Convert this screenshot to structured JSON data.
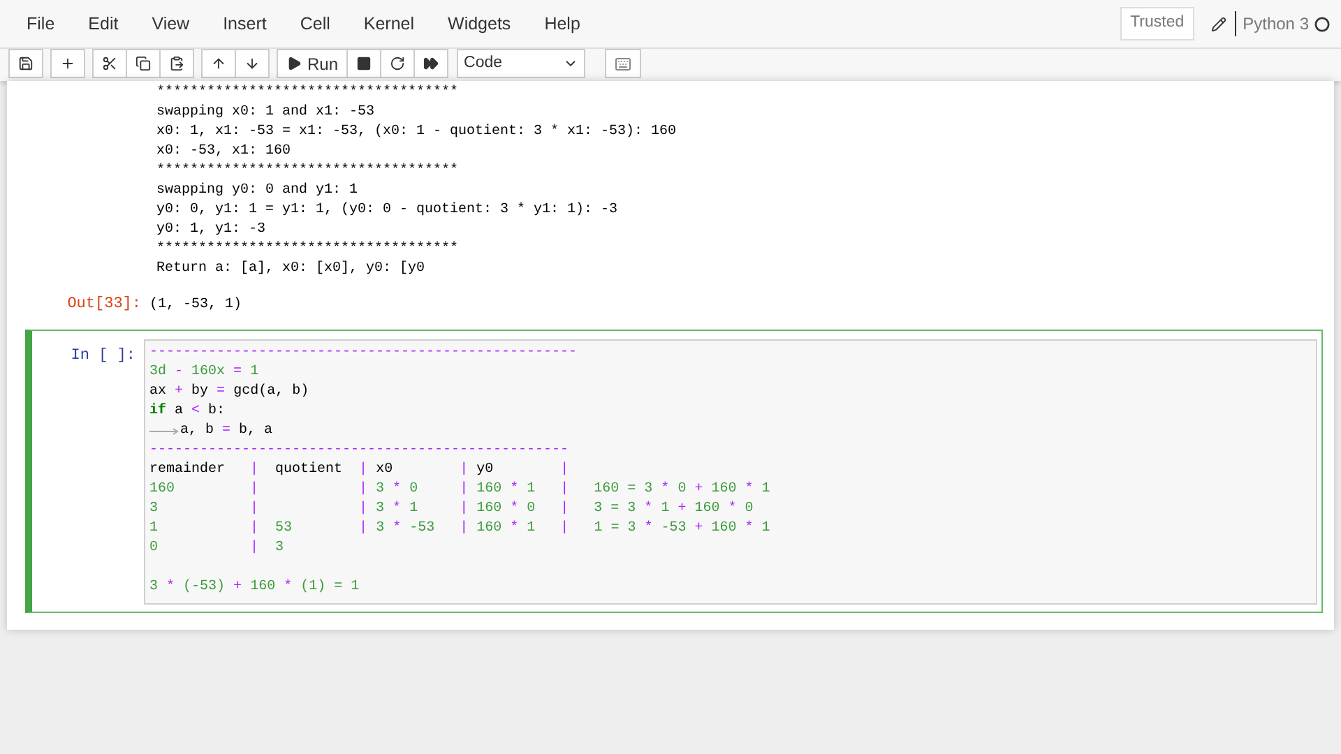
{
  "menu": [
    "File",
    "Edit",
    "View",
    "Insert",
    "Cell",
    "Kernel",
    "Widgets",
    "Help"
  ],
  "header_right": {
    "trusted": "Trusted",
    "kernel": "Python 3"
  },
  "toolbar": {
    "groups": [
      [
        {
          "kind": "save"
        }
      ],
      [
        {
          "kind": "add"
        }
      ],
      [
        {
          "kind": "cut"
        },
        {
          "kind": "copy"
        },
        {
          "kind": "paste"
        }
      ],
      [
        {
          "kind": "up"
        },
        {
          "kind": "down"
        }
      ],
      [
        {
          "kind": "run",
          "label": "Run"
        },
        {
          "kind": "stop"
        },
        {
          "kind": "restart"
        },
        {
          "kind": "fast"
        }
      ]
    ],
    "cell_type": "Code"
  },
  "output": {
    "lines": [
      "************************************",
      "swapping x0: 1 and x1: -53",
      "x0: 1, x1: -53 = x1: -53, (x0: 1 - quotient: 3 * x1: -53): 160",
      "x0: -53, x1: 160",
      "************************************",
      "swapping y0: 0 and y1: 1",
      "y0: 0, y1: 1 = y1: 1, (y0: 0 - quotient: 3 * y1: 1): -3",
      "y0: 1, y1: -3",
      "************************************",
      "Return a: [a], x0: [x0], y0: [y0"
    ],
    "out_prompt": "Out[33]:",
    "out_value": "(1, -53, 1)"
  },
  "input_cell": {
    "prompt": "In [ ]:",
    "selected": true,
    "lines": [
      {
        "kind": "code",
        "tokens": [
          {
            "t": "---------------------------------------------------",
            "kind": "op"
          }
        ]
      },
      {
        "kind": "code",
        "tokens": [
          {
            "t": "3d",
            "kind": "num"
          },
          {
            "t": " - ",
            "kind": "op"
          },
          {
            "t": "160x",
            "kind": "num"
          },
          {
            "t": " = ",
            "kind": "op"
          },
          {
            "t": "1",
            "kind": "num"
          }
        ]
      },
      {
        "kind": "code",
        "tokens": [
          {
            "t": "ax ",
            "kind": "plain"
          },
          {
            "t": "+",
            "kind": "op"
          },
          {
            "t": " by ",
            "kind": "plain"
          },
          {
            "t": "=",
            "kind": "op"
          },
          {
            "t": " gcd(a, b)",
            "kind": "plain"
          }
        ]
      },
      {
        "kind": "code",
        "tokens": [
          {
            "t": "if",
            "kind": "kw"
          },
          {
            "t": " a ",
            "kind": "plain"
          },
          {
            "t": "<",
            "kind": "op"
          },
          {
            "t": " b:",
            "kind": "plain"
          }
        ]
      },
      {
        "kind": "code",
        "indent": true,
        "tokens": [
          {
            "t": "a, b ",
            "kind": "plain"
          },
          {
            "t": "=",
            "kind": "op"
          },
          {
            "t": " b, a",
            "kind": "plain"
          }
        ]
      },
      {
        "kind": "code",
        "tokens": [
          {
            "t": "--------------------------------------------------",
            "kind": "op"
          }
        ]
      },
      {
        "kind": "code",
        "tokens": [
          {
            "t": "remainder   ",
            "kind": "plain"
          },
          {
            "t": "|",
            "kind": "op"
          },
          {
            "t": "  quotient  ",
            "kind": "plain"
          },
          {
            "t": "|",
            "kind": "op"
          },
          {
            "t": " x0        ",
            "kind": "plain"
          },
          {
            "t": "|",
            "kind": "op"
          },
          {
            "t": " y0        ",
            "kind": "plain"
          },
          {
            "t": "|",
            "kind": "op"
          }
        ]
      },
      {
        "kind": "code",
        "tokens": [
          {
            "t": "160         ",
            "kind": "num"
          },
          {
            "t": "|            |",
            "kind": "op"
          },
          {
            "t": " 3 ",
            "kind": "num"
          },
          {
            "t": "*",
            "kind": "op"
          },
          {
            "t": " 0     ",
            "kind": "num"
          },
          {
            "t": "|",
            "kind": "op"
          },
          {
            "t": " 160 ",
            "kind": "num"
          },
          {
            "t": "*",
            "kind": "op"
          },
          {
            "t": " 1   ",
            "kind": "num"
          },
          {
            "t": "|",
            "kind": "op"
          },
          {
            "t": "   160 = 3 ",
            "kind": "num"
          },
          {
            "t": "*",
            "kind": "op"
          },
          {
            "t": " 0 ",
            "kind": "num"
          },
          {
            "t": "+",
            "kind": "op"
          },
          {
            "t": " 160 ",
            "kind": "num"
          },
          {
            "t": "*",
            "kind": "op"
          },
          {
            "t": " 1",
            "kind": "num"
          }
        ]
      },
      {
        "kind": "code",
        "tokens": [
          {
            "t": "3           ",
            "kind": "num"
          },
          {
            "t": "|            |",
            "kind": "op"
          },
          {
            "t": " 3 ",
            "kind": "num"
          },
          {
            "t": "*",
            "kind": "op"
          },
          {
            "t": " 1     ",
            "kind": "num"
          },
          {
            "t": "|",
            "kind": "op"
          },
          {
            "t": " 160 ",
            "kind": "num"
          },
          {
            "t": "*",
            "kind": "op"
          },
          {
            "t": " 0   ",
            "kind": "num"
          },
          {
            "t": "|",
            "kind": "op"
          },
          {
            "t": "   3 = 3 ",
            "kind": "num"
          },
          {
            "t": "*",
            "kind": "op"
          },
          {
            "t": " 1 ",
            "kind": "num"
          },
          {
            "t": "+",
            "kind": "op"
          },
          {
            "t": " 160 ",
            "kind": "num"
          },
          {
            "t": "*",
            "kind": "op"
          },
          {
            "t": " 0",
            "kind": "num"
          }
        ]
      },
      {
        "kind": "code",
        "tokens": [
          {
            "t": "1           ",
            "kind": "num"
          },
          {
            "t": "|",
            "kind": "op"
          },
          {
            "t": "  53        ",
            "kind": "num"
          },
          {
            "t": "|",
            "kind": "op"
          },
          {
            "t": " 3 ",
            "kind": "num"
          },
          {
            "t": "*",
            "kind": "op"
          },
          {
            "t": " -53   ",
            "kind": "num"
          },
          {
            "t": "|",
            "kind": "op"
          },
          {
            "t": " 160 ",
            "kind": "num"
          },
          {
            "t": "*",
            "kind": "op"
          },
          {
            "t": " 1   ",
            "kind": "num"
          },
          {
            "t": "|",
            "kind": "op"
          },
          {
            "t": "   1 = 3 ",
            "kind": "num"
          },
          {
            "t": "*",
            "kind": "op"
          },
          {
            "t": " -53 ",
            "kind": "num"
          },
          {
            "t": "+",
            "kind": "op"
          },
          {
            "t": " 160 ",
            "kind": "num"
          },
          {
            "t": "*",
            "kind": "op"
          },
          {
            "t": " 1",
            "kind": "num"
          }
        ]
      },
      {
        "kind": "code",
        "tokens": [
          {
            "t": "0           ",
            "kind": "num"
          },
          {
            "t": "|",
            "kind": "op"
          },
          {
            "t": "  3",
            "kind": "num"
          }
        ]
      },
      {
        "kind": "blank"
      },
      {
        "kind": "code",
        "tokens": [
          {
            "t": "3 ",
            "kind": "num"
          },
          {
            "t": "*",
            "kind": "op"
          },
          {
            "t": " (-53) ",
            "kind": "num"
          },
          {
            "t": "+",
            "kind": "op"
          },
          {
            "t": " 160 ",
            "kind": "num"
          },
          {
            "t": "*",
            "kind": "op"
          },
          {
            "t": " (1) = 1",
            "kind": "num"
          }
        ]
      }
    ]
  }
}
